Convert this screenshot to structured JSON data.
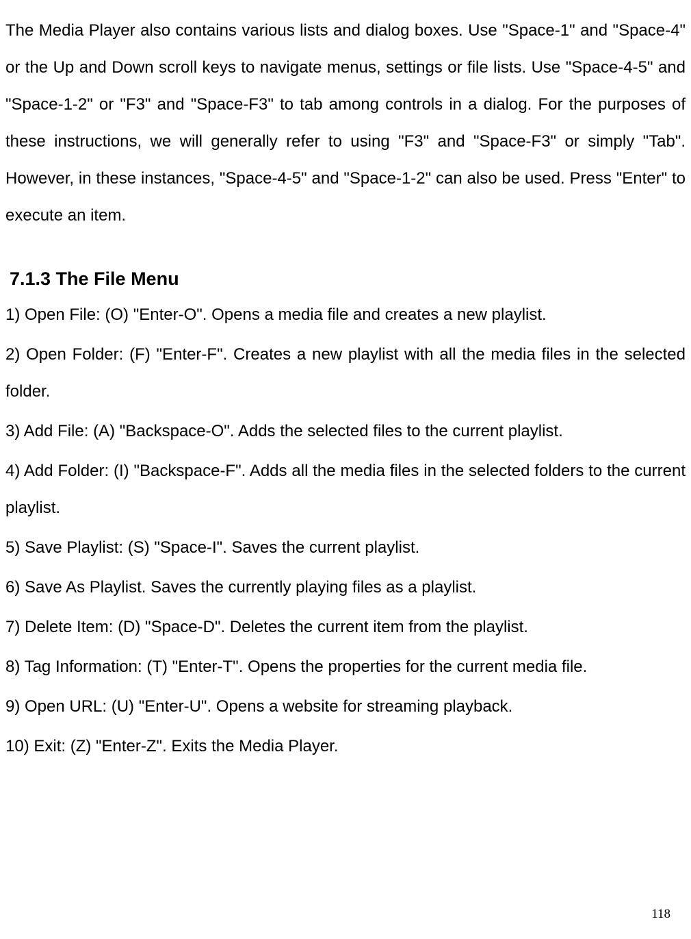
{
  "intro": "The Media Player also contains various lists and dialog boxes. Use \"Space-1\" and \"Space-4\" or the Up and Down scroll keys to navigate menus, settings or file lists. Use \"Space-4-5\" and \"Space-1-2\" or \"F3\" and \"Space-F3\" to tab among controls in a dialog. For the purposes of these instructions, we will generally refer to using \"F3\" and \"Space-F3\" or simply \"Tab\". However, in these instances, \"Space-4-5\" and \"Space-1-2\" can also be used. Press \"Enter\" to execute an item.",
  "heading": "7.1.3 The File Menu",
  "items": [
    "1) Open File: (O) \"Enter-O\". Opens a media file and creates a new playlist.",
    "2) Open Folder: (F) \"Enter-F\". Creates a new playlist with all the media files in the selected folder.",
    "3) Add File: (A) \"Backspace-O\". Adds the selected files to the current playlist.",
    "4) Add Folder: (I) \"Backspace-F\". Adds all the media files in the selected folders to the current playlist.",
    "5) Save Playlist: (S) \"Space-I\". Saves the current playlist.",
    "6) Save As Playlist. Saves the currently playing files as a playlist.",
    "7) Delete Item: (D) \"Space-D\". Deletes the current item from the playlist.",
    "8) Tag Information: (T) \"Enter-T\". Opens the properties for the current media file.",
    "9) Open URL: (U) \"Enter-U\". Opens a website for streaming playback.",
    "10) Exit: (Z) \"Enter-Z\". Exits the Media Player."
  ],
  "pageNumber": "118"
}
